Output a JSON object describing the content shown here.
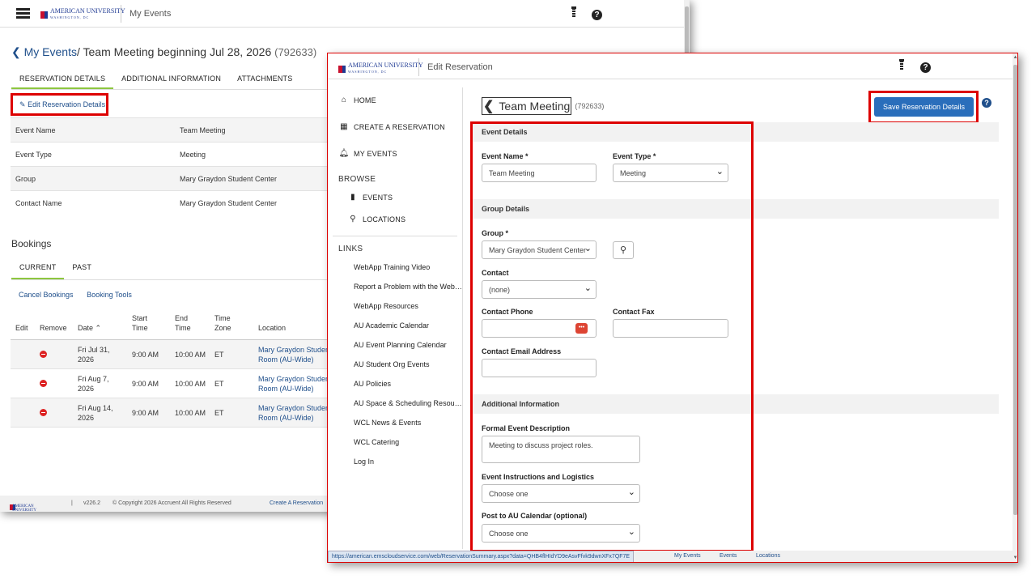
{
  "back": {
    "app_title": "My Events",
    "logo_text": "AMERICAN UNIVERSITY",
    "logo_sub": "WASHINGTON, DC",
    "breadcrumb": {
      "link": "My Events",
      "sep": "/",
      "title": "Team Meeting beginning Jul 28, 2026",
      "number": "(792633)"
    },
    "tabs": [
      "RESERVATION DETAILS",
      "ADDITIONAL INFORMATION",
      "ATTACHMENTS"
    ],
    "edit_button": "Edit Reservation Details",
    "details": [
      {
        "key": "Event Name",
        "value": "Team Meeting"
      },
      {
        "key": "Event Type",
        "value": "Meeting"
      },
      {
        "key": "Group",
        "value": "Mary Graydon Student Center"
      },
      {
        "key": "Contact Name",
        "value": "Mary Graydon Student Center"
      }
    ],
    "bookings_heading": "Bookings",
    "booking_tabs": [
      "CURRENT",
      "PAST"
    ],
    "booking_links": [
      "Cancel Bookings",
      "Booking Tools"
    ],
    "booking_columns": {
      "edit": "Edit",
      "remove": "Remove",
      "date": "Date ⌃",
      "start1": "Start",
      "start2": "Time",
      "end1": "End",
      "end2": "Time",
      "tz1": "Time",
      "tz2": "Zone",
      "location": "Location"
    },
    "bookings": [
      {
        "date1": "Fri Jul 31,",
        "date2": "2026",
        "start": "9:00 AM",
        "end": "10:00 AM",
        "tz": "ET",
        "loc1": "Mary Graydon Studen",
        "loc2": "Room (AU-Wide)"
      },
      {
        "date1": "Fri Aug 7,",
        "date2": "2026",
        "start": "9:00 AM",
        "end": "10:00 AM",
        "tz": "ET",
        "loc1": "Mary Graydon Studen",
        "loc2": "Room (AU-Wide)"
      },
      {
        "date1": "Fri Aug 14,",
        "date2": "2026",
        "start": "9:00 AM",
        "end": "10:00 AM",
        "tz": "ET",
        "loc1": "Mary Graydon Studen",
        "loc2": "Room (AU-Wide)"
      }
    ],
    "footer": {
      "version": "v226.2",
      "copyright": "© Copyright 2026 Accruent All Rights Reserved",
      "link": "Create A Reservation"
    }
  },
  "front": {
    "app_title": "Edit Reservation",
    "nav": [
      {
        "icon": "home-icon",
        "label": "HOME"
      },
      {
        "icon": "calendar-icon",
        "label": "CREATE A RESERVATION"
      },
      {
        "icon": "bell-icon",
        "label": "MY EVENTS"
      }
    ],
    "browse_label": "BROWSE",
    "browse_items": [
      {
        "icon": "bookmark-icon",
        "label": "EVENTS"
      },
      {
        "icon": "map-pin-icon",
        "label": "LOCATIONS"
      }
    ],
    "links_label": "LINKS",
    "links": [
      "WebApp Training Video",
      "Report a Problem with the WebApp",
      "WebApp Resources",
      "AU Academic Calendar",
      "AU Event Planning Calendar",
      "AU Student Org Events",
      "AU Policies",
      "AU Space & Scheduling Resources",
      "WCL News & Events",
      "WCL Catering",
      "Log In"
    ],
    "title": "Team Meeting",
    "number": "(792633)",
    "save_button": "Save Reservation Details",
    "sections": {
      "event_details": "Event Details",
      "group_details": "Group Details",
      "additional_info": "Additional Information"
    },
    "fields": {
      "event_name_label": "Event Name *",
      "event_name_value": "Team Meeting",
      "event_type_label": "Event Type *",
      "event_type_value": "Meeting",
      "group_label": "Group *",
      "group_value": "Mary Graydon Student Center",
      "contact_label": "Contact",
      "contact_value": "(none)",
      "contact_phone_label": "Contact Phone",
      "contact_fax_label": "Contact Fax",
      "contact_email_label": "Contact Email Address",
      "description_label": "Formal Event Description",
      "description_value": "Meeting to discuss project roles.",
      "instructions_label": "Event Instructions and Logistics",
      "instructions_value": "Choose one",
      "calendar_label": "Post to AU Calendar (optional)",
      "calendar_value": "Choose one"
    },
    "status_url": "https://american.emscloudservice.com/web/ReservationSummary.aspx?data=QHB4flHIdYD9eAsvFfvk9dwnXFx7QF7E",
    "status_links": [
      "My Events",
      "Events",
      "Locations"
    ]
  }
}
